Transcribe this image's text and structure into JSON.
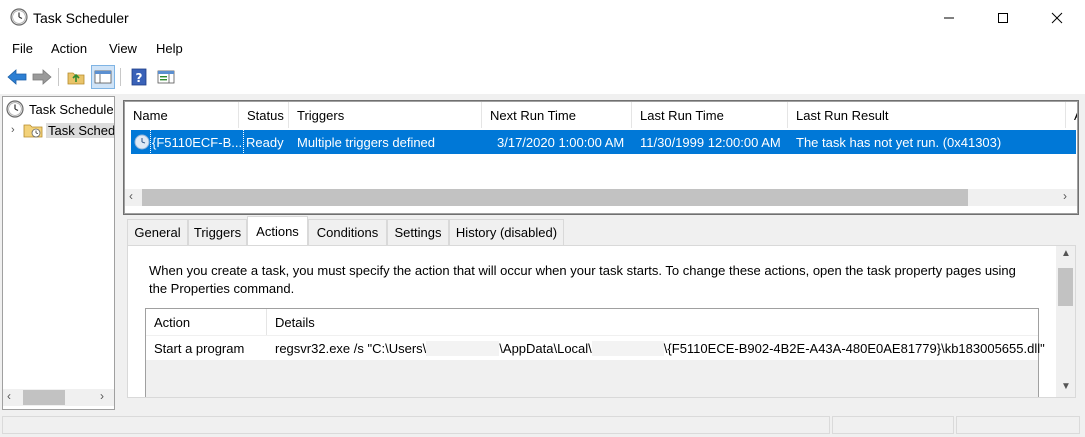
{
  "window": {
    "title": "Task Scheduler"
  },
  "menu": [
    "File",
    "Action",
    "View",
    "Help"
  ],
  "toolbar": {
    "icons": [
      "back-arrow-icon",
      "forward-arrow-icon",
      "up-folder-icon",
      "show-hide-console-tree-icon",
      "help-icon",
      "action-pane-icon"
    ]
  },
  "tree": {
    "root_label": "Task Scheduler",
    "child_label": "Task Sched"
  },
  "tasks": {
    "columns": [
      "Name",
      "Status",
      "Triggers",
      "Next Run Time",
      "Last Run Time",
      "Last Run Result",
      "A"
    ],
    "rows": [
      {
        "name": "{F5110ECF-B...",
        "status": "Ready",
        "triggers": "Multiple triggers defined",
        "next_run": "3/17/2020 1:00:00 AM",
        "last_run": "11/30/1999 12:00:00 AM",
        "last_result": "The task has not yet run. (0x41303)"
      }
    ]
  },
  "tabs": [
    "General",
    "Triggers",
    "Actions",
    "Conditions",
    "Settings",
    "History (disabled)"
  ],
  "active_tab": "Actions",
  "actions_pane": {
    "description": "When you create a task, you must specify the action that will occur when your task starts.  To change these actions, open the task property pages using the Properties command.",
    "columns": [
      "Action",
      "Details"
    ],
    "rows": [
      {
        "action": "Start a program",
        "details_part1": "regsvr32.exe /s \"C:\\Users\\",
        "details_part2": "\\AppData\\Local\\",
        "details_part3": "\\{F5110ECE-B902-4B2E-A43A-480E0AE81779}\\kb183005655.dll\""
      }
    ]
  },
  "colors": {
    "selection": "#0078d7",
    "chrome": "#f0f0f0"
  }
}
